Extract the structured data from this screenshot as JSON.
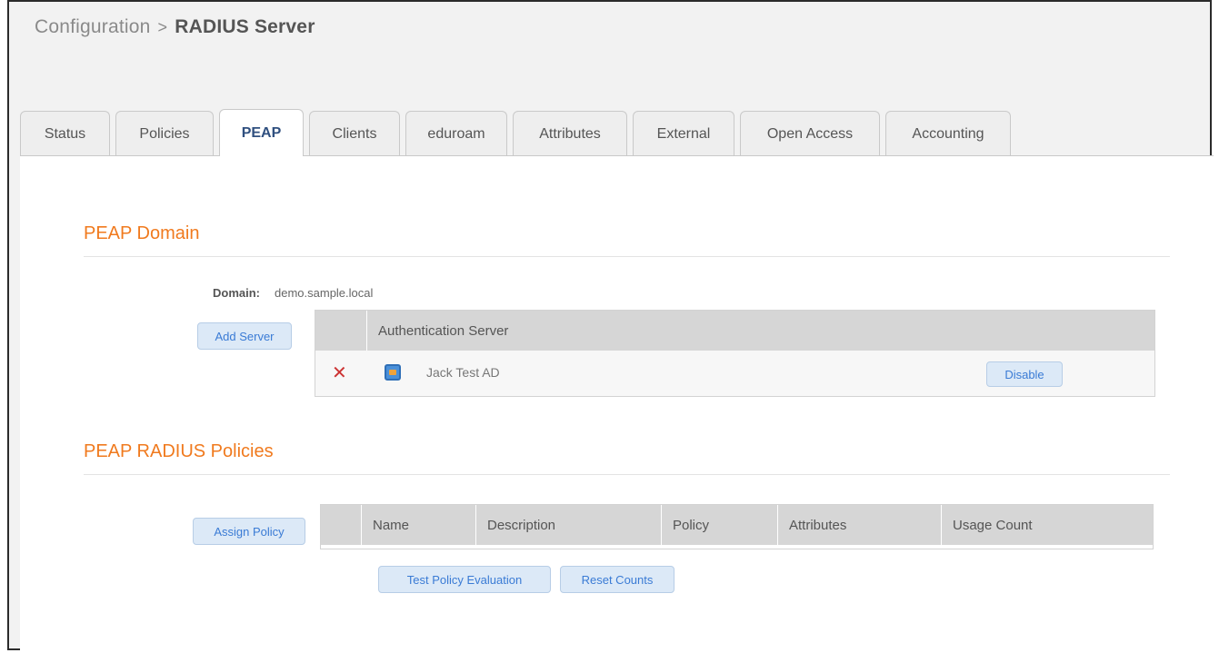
{
  "breadcrumb": {
    "parent": "Configuration",
    "separator": ">",
    "current": "RADIUS Server"
  },
  "tabs": [
    {
      "label": "Status",
      "active": false
    },
    {
      "label": "Policies",
      "active": false
    },
    {
      "label": "PEAP",
      "active": true
    },
    {
      "label": "Clients",
      "active": false
    },
    {
      "label": "eduroam",
      "active": false
    },
    {
      "label": "Attributes",
      "active": false
    },
    {
      "label": "External",
      "active": false
    },
    {
      "label": "Open Access",
      "active": false
    },
    {
      "label": "Accounting",
      "active": false
    }
  ],
  "peap_domain": {
    "title": "PEAP Domain",
    "domain_label": "Domain:",
    "domain_value": "demo.sample.local",
    "add_server_label": "Add Server",
    "table_header": "Authentication Server",
    "servers": [
      {
        "name": "Jack Test AD",
        "action_label": "Disable",
        "icon": "server-icon",
        "delete_icon": "delete-x-icon"
      }
    ]
  },
  "peap_policies": {
    "title": "PEAP RADIUS Policies",
    "assign_policy_label": "Assign Policy",
    "columns": [
      "Name",
      "Description",
      "Policy",
      "Attributes",
      "Usage Count"
    ],
    "rows": [],
    "test_policy_label": "Test Policy Evaluation",
    "reset_counts_label": "Reset Counts"
  },
  "colors": {
    "section_title": "#f07a1e",
    "active_tab_text": "#2f4f7f",
    "button_text": "#3a7bd5",
    "button_bg": "#dce9f7",
    "table_header_bg": "#d6d6d6",
    "delete_icon": "#cc3333"
  }
}
